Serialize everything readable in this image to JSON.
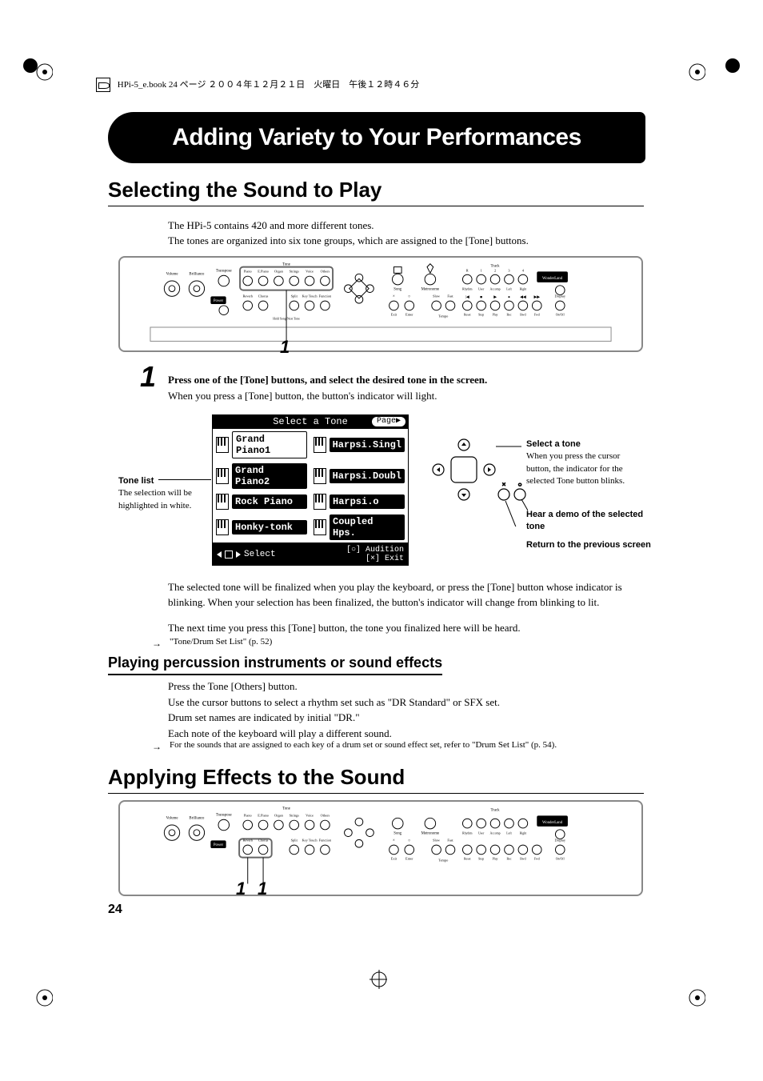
{
  "header_line": "HPi-5_e.book 24 ページ ２００４年１２月２１日　火曜日　午後１２時４６分",
  "chapter_title": "Adding Variety to Your Performances",
  "section1_title": "Selecting the Sound to Play",
  "intro1": "The HPi-5 contains 420 and more different tones.",
  "intro2": "The tones are organized into six tone groups, which are assigned to the [Tone] buttons.",
  "panel1_callout_num": "1",
  "step1_num": "1",
  "step1_bold": "Press one of the [Tone] buttons, and select the desired tone in the screen.",
  "step1_line2": "When you press a [Tone] button, the button's indicator will light.",
  "tone_screen": {
    "title": "Select a Tone",
    "page_label": "Page",
    "rows": [
      [
        "Grand Piano1",
        "Harpsi.Singl"
      ],
      [
        "Grand Piano2",
        "Harpsi.Doubl"
      ],
      [
        "Rock Piano",
        "Harpsi.o"
      ],
      [
        "Honky-tonk",
        "Coupled Hps."
      ]
    ],
    "footer_select": "Select",
    "footer_audition": "[○] Audition",
    "footer_exit": "[×] Exit"
  },
  "left_label_title": "Tone list",
  "left_label_text": "The selection will be highlighted in white.",
  "right_label1_title": "Select a tone",
  "right_label1_text": "When you press the cursor button, the indicator for the selected Tone button blinks.",
  "right_label2_title": "Hear a demo of the selected tone",
  "right_label3_title": "Return to the previous screen",
  "post_para1": "The selected tone will be finalized when you play the keyboard, or press the [Tone] button whose indicator is blinking. When your selection has been finalized, the button's indicator will change from blinking to lit.",
  "post_para2": "The next time you press this [Tone] button, the tone you finalized here will be heard.",
  "crossref1": "\"Tone/Drum Set List\" (p. 52)",
  "subhead": "Playing percussion instruments or sound effects",
  "perc_l1": "Press the Tone [Others] button.",
  "perc_l2": "Use the cursor buttons to select a rhythm set such as \"DR Standard\" or SFX set.",
  "perc_l3": "Drum set names are indicated by initial \"DR.\"",
  "perc_l4": "Each note of the keyboard will play a different sound.",
  "crossref2": "For the sounds that are assigned to each key of a drum set or sound effect set, refer to \"Drum Set List\" (p. 54).",
  "section2_title": "Applying Effects to the Sound",
  "panel2_left_num": "1",
  "panel2_right_num": "1",
  "page_number": "24",
  "panel_label": {
    "volume": "Volume",
    "brilliance": "Brilliance",
    "tone_group": "Tone",
    "transpose": "Transpose",
    "piano": "Piano",
    "epiano": "E.Piano",
    "organ": "Organ",
    "strings": "Strings",
    "voice": "Voice",
    "others": "Others",
    "power": "Power",
    "reverb": "Reverb",
    "chorus": "Chorus",
    "split": "Split",
    "keytouch": "Key Touch",
    "function": "Function",
    "song": "Song",
    "metronome": "Metronome",
    "exit": "Exit",
    "enter": "Enter",
    "x": "×",
    "o": "○",
    "slow": "Slow",
    "fast": "Fast",
    "tempo": "Tempo",
    "track": "Track",
    "rhythm": "Rhythm",
    "user": "User",
    "accomp": "Accomp",
    "left": "Left",
    "right": "Right",
    "wonderland": "WonderLand",
    "reset": "Reset",
    "stop": "Stop",
    "play": "Play",
    "rec": "Rec",
    "bwd": "Bwd",
    "fwd": "Fwd",
    "display": "Display",
    "onoff": "On/Off"
  }
}
